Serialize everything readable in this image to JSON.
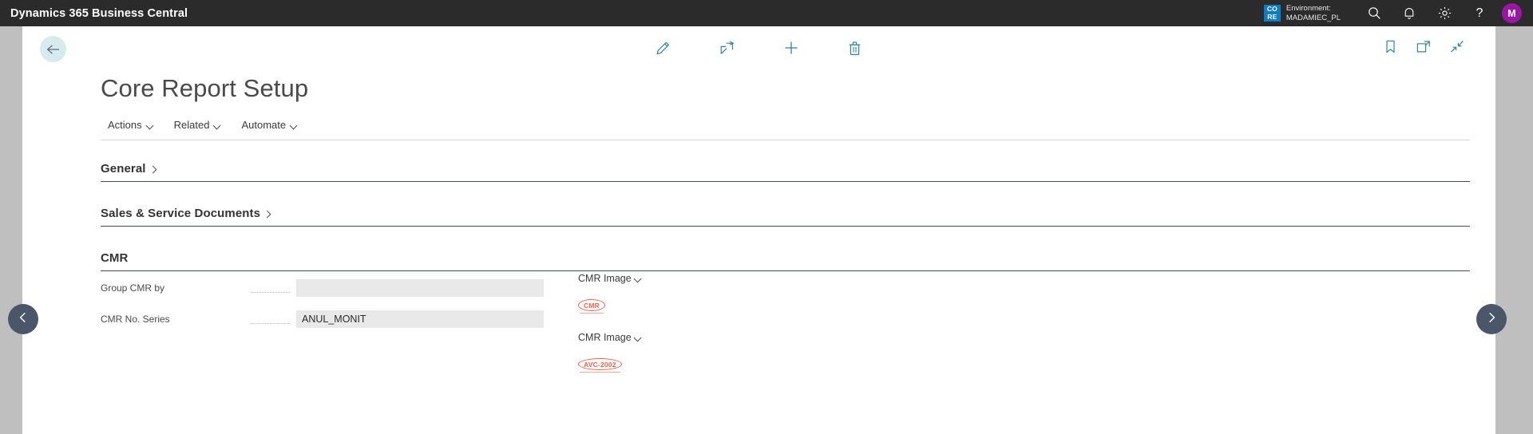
{
  "topbar": {
    "brand": "Dynamics 365 Business Central",
    "core_badge_line1": "CO",
    "core_badge_line2": "RE",
    "environment_label": "Environment:",
    "environment_name": "MADAMIEC_PL",
    "search_icon": "search-icon",
    "notifications_icon": "bell-icon",
    "settings_icon": "gear-icon",
    "help_icon": "question-mark-icon",
    "avatar_initial": "M",
    "avatar_color": "#9b16a5",
    "badge_color": "#0f7bc4",
    "background_color": "#2b2b2b"
  },
  "commandbar": {
    "back_icon": "back-arrow-icon",
    "edit_label": "Edit",
    "edit_icon": "pencil-icon",
    "share_label": "Share",
    "share_icon": "share-icon",
    "new_label": "New",
    "new_icon": "plus-icon",
    "delete_label": "Delete",
    "delete_icon": "trash-icon",
    "bookmark_label": "Bookmark",
    "bookmark_icon": "bookmark-icon",
    "openinnew_label": "Open in new window",
    "openinnew_icon": "open-in-new-window-icon",
    "collapse_label": "Collapse",
    "collapse_icon": "collapse-diagonal-icon",
    "accent_color": "#2e8795"
  },
  "page": {
    "title": "Core Report Setup"
  },
  "menubar": {
    "items": [
      {
        "label": "Actions"
      },
      {
        "label": "Related"
      },
      {
        "label": "Automate"
      }
    ]
  },
  "sections": [
    {
      "title": "General",
      "expanded": false
    },
    {
      "title": "Sales & Service Documents",
      "expanded": false
    },
    {
      "title": "CMR",
      "expanded": true
    }
  ],
  "cmr_form": {
    "fields": [
      {
        "label": "Group CMR by",
        "value": "",
        "placeholder": ""
      },
      {
        "label": "CMR No. Series",
        "value": "ANUL_MONIT",
        "placeholder": ""
      }
    ],
    "images": [
      {
        "caption": "CMR Image",
        "stamp_text": "CMR",
        "stamp_color": "#f4604c"
      },
      {
        "caption": "CMR Image",
        "stamp_text": "AVC-2002",
        "stamp_color": "#f4604c"
      }
    ]
  },
  "sidenav": {
    "previous_label": "Previous",
    "previous_icon": "chevron-left-icon",
    "next_label": "Next",
    "next_icon": "chevron-right-icon"
  }
}
